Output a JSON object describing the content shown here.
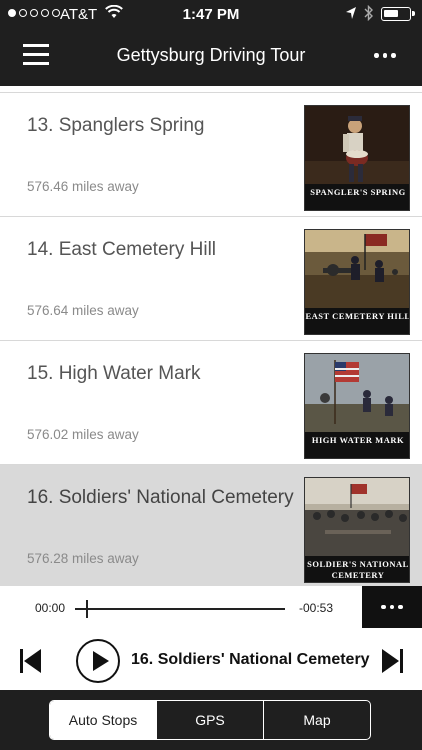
{
  "status_bar": {
    "carrier": "AT&T",
    "time": "1:47 PM",
    "signal_bars_filled": 1,
    "signal_bars_total": 5,
    "battery_level": 0.6
  },
  "nav": {
    "title": "Gettysburg Driving Tour",
    "menu_icon": "hamburger-menu-icon",
    "more_icon": "ellipsis-icon"
  },
  "stops": [
    {
      "title": "13. Spanglers Spring",
      "distance": "576.46 miles away",
      "image_caption": "SPANGLER'S SPRING",
      "selected": false
    },
    {
      "title": "14. East Cemetery Hill",
      "distance": "576.64 miles away",
      "image_caption": "EAST CEMETERY HILL",
      "selected": false
    },
    {
      "title": "15. High Water Mark",
      "distance": "576.02 miles away",
      "image_caption": "HIGH WATER MARK",
      "selected": false
    },
    {
      "title": "16. Soldiers' National Cemetery",
      "distance": "576.28 miles away",
      "image_caption": "SOLDIER'S NATIONAL CEMETERY",
      "selected": true
    }
  ],
  "player": {
    "elapsed": "00:00",
    "remaining": "-00:53",
    "progress": 0.05,
    "now_playing": "16. Soldiers' National Cemetery"
  },
  "tabs": [
    {
      "label": "Auto Stops",
      "active": true
    },
    {
      "label": "GPS",
      "active": false
    },
    {
      "label": "Map",
      "active": false
    }
  ],
  "colors": {
    "header_bg": "#1f1f1f",
    "selected_row_bg": "#d9d9d9",
    "title_text": "#555555",
    "distance_text": "#8a8a8a"
  }
}
